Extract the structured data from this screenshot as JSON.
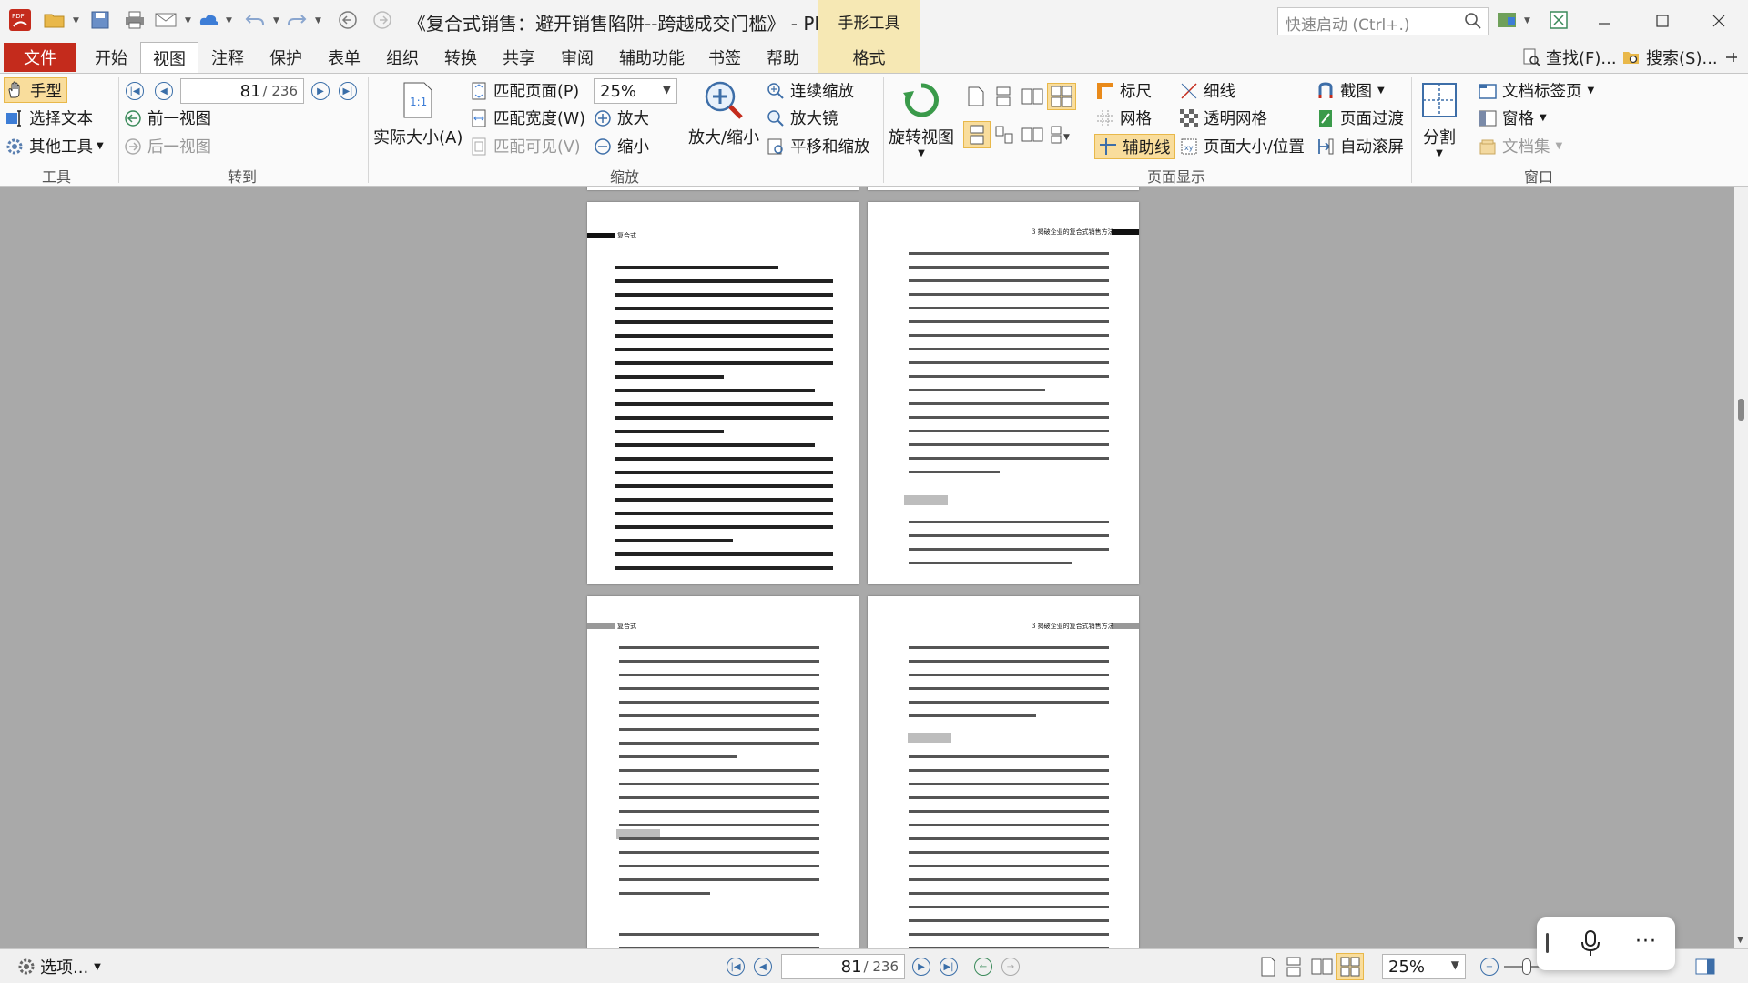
{
  "app": {
    "title": "《复合式销售：避开销售陷阱--跨越成交门槛》 - PDF-..",
    "context_tab_group": "手形工具",
    "quick_launch_placeholder": "快速启动 (Ctrl+.)"
  },
  "menu": {
    "tabs": [
      "文件",
      "开始",
      "视图",
      "注释",
      "保护",
      "表单",
      "组织",
      "转换",
      "共享",
      "审阅",
      "辅助功能",
      "书签",
      "帮助",
      "格式"
    ],
    "active": "视图",
    "find_label": "查找(F)...",
    "search_label": "搜索(S)..."
  },
  "ribbon": {
    "tools": {
      "label": "工具",
      "hand": "手型",
      "select_text": "选择文本",
      "other_tools": "其他工具"
    },
    "goto": {
      "label": "转到",
      "current_page": "81",
      "total_pages": "/ 236",
      "prev_view": "前一视图",
      "next_view": "后一视图"
    },
    "zoom": {
      "label": "缩放",
      "actual_size": "实际大小(A)",
      "fit_page": "匹配页面(P)",
      "fit_width": "匹配宽度(W)",
      "fit_visible": "匹配可见(V)",
      "zoom_value": "25%",
      "zoom_in": "放大",
      "zoom_out": "缩小",
      "zoom_inout": "放大/缩小",
      "continuous_zoom": "连续缩放",
      "magnifier": "放大镜",
      "pan_zoom": "平移和缩放"
    },
    "page_display": {
      "label": "页面显示",
      "rotate_view": "旋转视图",
      "ruler": "标尺",
      "grid": "网格",
      "guides": "辅助线",
      "thin_lines": "细线",
      "transparent_grid": "透明网格",
      "page_box": "页面大小/位置",
      "snapshot": "截图",
      "page_transition": "页面过渡",
      "auto_scroll": "自动滚屏"
    },
    "window": {
      "label": "窗口",
      "split": "分割",
      "doc_tabs": "文档标签页",
      "panes": "窗格",
      "doc_sets": "文档集"
    }
  },
  "pages": {
    "p1_header": "复合式",
    "p2_header": "3 揭破企业的复合式销售方法",
    "p3_header": "复合式",
    "p4_header": "3 揭破企业的复合式销售方法"
  },
  "statusbar": {
    "options": "选项...",
    "current_page": "81",
    "total_pages": "/ 236",
    "zoom_value": "25%"
  },
  "colors": {
    "file_tab": "#c42b1c",
    "context_tab": "#f6e8b4",
    "highlight": "#f9dd9c",
    "doc_background": "#a9a9a9"
  }
}
